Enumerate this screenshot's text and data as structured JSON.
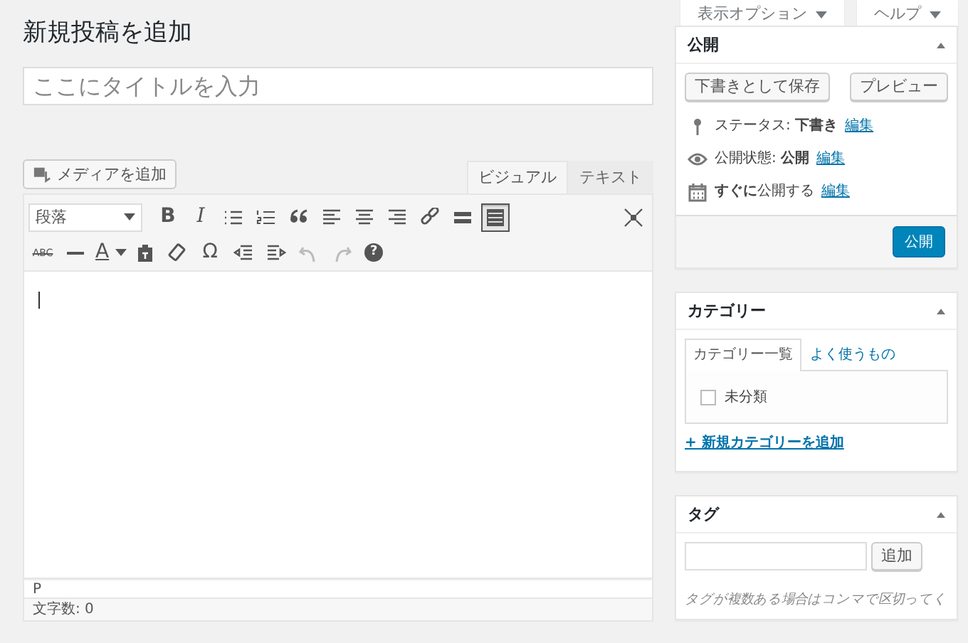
{
  "top_buttons": [
    {
      "label": "表示オプション"
    },
    {
      "label": "ヘルプ"
    }
  ],
  "page_title": "新規投稿を追加",
  "title_field": {
    "placeholder": "ここにタイトルを入力"
  },
  "media_button": "メディアを追加",
  "editor_tabs": [
    {
      "label": "ビジュアル",
      "selected": true
    },
    {
      "label": "テキスト",
      "selected": false
    }
  ],
  "toolbar_rows": [
    [
      {
        "kind": "select",
        "text": "段落"
      },
      {
        "kind": "bold",
        "text": "B"
      },
      {
        "kind": "italic",
        "text": "I"
      },
      {
        "kind": "bullets"
      },
      {
        "kind": "numbers"
      },
      {
        "kind": "quote"
      },
      {
        "kind": "align-left"
      },
      {
        "kind": "align-center"
      },
      {
        "kind": "align-right"
      },
      {
        "kind": "link"
      },
      {
        "kind": "more"
      },
      {
        "kind": "toggle",
        "selected": true
      }
    ],
    [
      {
        "kind": "strike",
        "text": "ABC"
      },
      {
        "kind": "rule"
      },
      {
        "kind": "color",
        "text": "A"
      },
      {
        "kind": "paste"
      },
      {
        "kind": "eraser"
      },
      {
        "kind": "char",
        "text": "Ω"
      },
      {
        "kind": "outdent"
      },
      {
        "kind": "indent"
      },
      {
        "kind": "undo",
        "disabled": true
      },
      {
        "kind": "redo",
        "disabled": true
      },
      {
        "kind": "help",
        "text": "?"
      }
    ]
  ],
  "path": "P",
  "word_count": "文字数: 0",
  "publish": {
    "title": "公開",
    "save_draft": "下書きとして保存",
    "preview": "プレビュー",
    "rows": [
      {
        "kind": "pin",
        "text": "ステータス: **下書き**",
        "link": "編集"
      },
      {
        "kind": "eye",
        "text": "公開状態: **公開**",
        "link": "編集"
      },
      {
        "kind": "calendar",
        "text": "**すぐに**公開する",
        "link": "編集"
      }
    ],
    "publish_button": "公開"
  },
  "categories": {
    "title": "カテゴリー",
    "tabs": [
      {
        "label": "カテゴリー一覧",
        "selected": true
      },
      {
        "label": "よく使うもの",
        "selected": false
      }
    ],
    "items": [
      {
        "label": "未分類",
        "checked": false
      }
    ],
    "add_link": "+ 新規カテゴリーを追加"
  },
  "tags": {
    "title": "タグ",
    "add_button": "追加",
    "hint": "タグが複数ある場合はコンマで区切ってく"
  }
}
